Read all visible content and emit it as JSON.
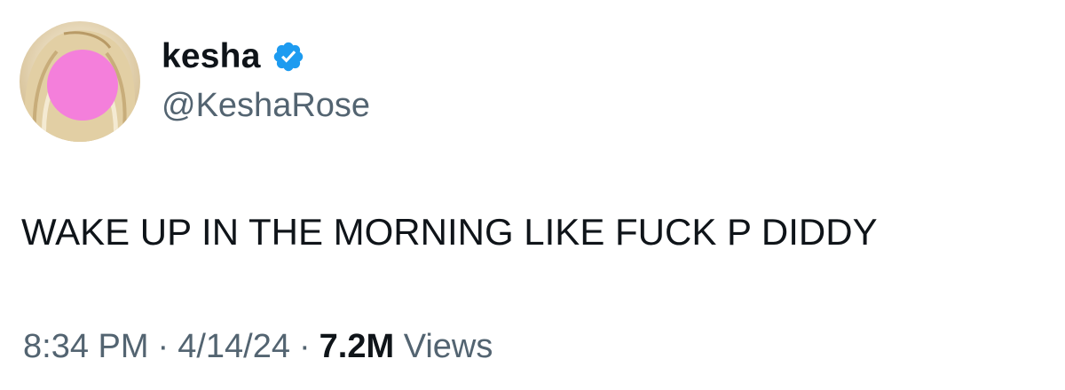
{
  "author": {
    "display_name": "kesha",
    "handle": "@KeshaRose",
    "verified": true,
    "verified_color": "#1d9bf0",
    "avatar_overlay_color": "#f47fdb",
    "avatar_icon": "profile-photo"
  },
  "tweet": {
    "text": "WAKE UP IN THE MORNING LIKE FUCK P DIDDY"
  },
  "meta": {
    "time": "8:34 PM",
    "separator": "·",
    "date": "4/14/24",
    "views_count": "7.2M",
    "views_label": "Views"
  },
  "colors": {
    "text_primary": "#0f1419",
    "text_secondary": "#536471",
    "background": "#ffffff"
  }
}
